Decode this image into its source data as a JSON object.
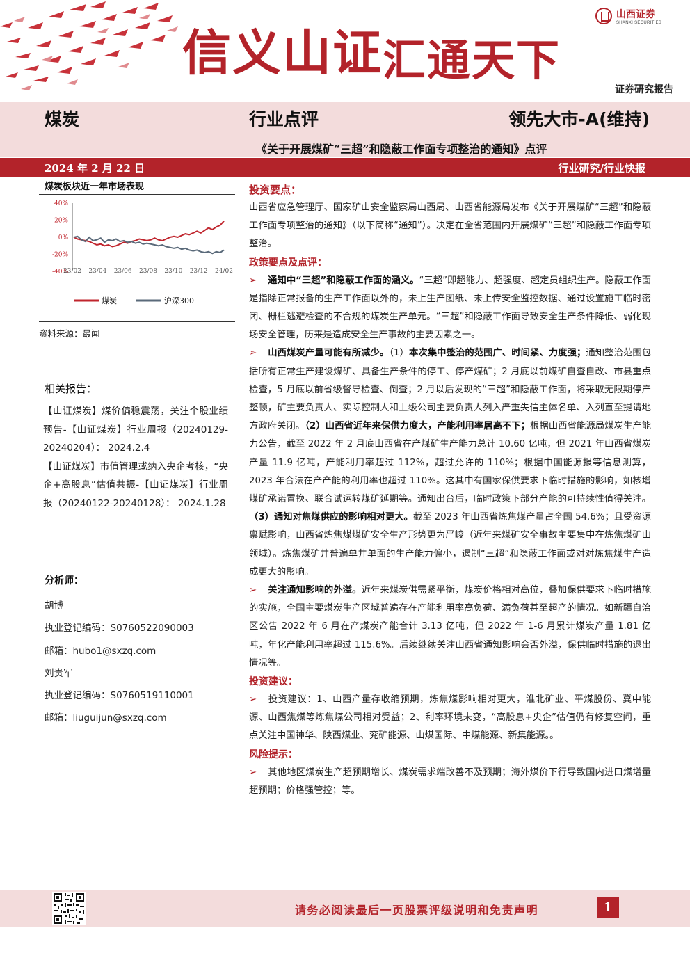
{
  "header": {
    "slogan_part1": "信义山证",
    "slogan_part2": "汇通天下",
    "logo_cn": "山西证券",
    "logo_en": "SHANXI SECURITIES",
    "report_type": "证券研究报告",
    "industry": "煤炭",
    "doc_type": "行业点评",
    "rating": "领先大市-A(维持)",
    "subtitle": "《关于开展煤矿“三超”和隐蔽工作面专项整治的通知》点评",
    "date": "2024 年 2 月 22 日",
    "category": "行业研究/行业快报",
    "colors": {
      "brand_red": "#b3232a",
      "band_pink": "#f3dcdc"
    }
  },
  "sidebar": {
    "chart_title": "煤炭板块近一年市场表现",
    "source": "资料来源：最闻",
    "related_title": "相关报告：",
    "related": [
      "【山证煤炭】煤价偏稳震荡，关注个股业绩预告-【山证煤炭】行业周报（20240129-20240204）：  2024.2.4",
      "【山证煤炭】市值管理或纳入央企考核，“央企+高股息”估值共振-【山证煤炭】行业周报（20240122-20240128）：  2024.1.28"
    ],
    "analyst_title": "分析师：",
    "analysts": [
      {
        "name": "胡博",
        "reg": "执业登记编码：S0760522090003",
        "email": "邮箱：hubo1@sxzq.com"
      },
      {
        "name": "刘贵军",
        "reg": "执业登记编码：S0760519110001",
        "email": "邮箱：liuguijun@sxzq.com"
      }
    ]
  },
  "chart_data": {
    "type": "line",
    "title": "煤炭板块近一年市场表现",
    "x": [
      "23/02",
      "23/04",
      "23/06",
      "23/08",
      "23/10",
      "23/12",
      "24/02"
    ],
    "ylim": [
      -40,
      40
    ],
    "yticks": [
      "40%",
      "20%",
      "0%",
      "-20%",
      "-40%"
    ],
    "series": [
      {
        "name": "煤炭",
        "color": "#c0252d",
        "values": [
          0,
          -2,
          -3,
          -4,
          -5,
          -7,
          -9,
          -8,
          -10,
          -9,
          -11,
          -10,
          -8,
          -6,
          -7,
          -5,
          -4,
          -2,
          -3,
          -4,
          -3,
          -1,
          -3,
          -4,
          -2,
          0,
          1,
          0,
          2,
          4,
          3,
          5,
          7,
          5,
          8,
          11,
          9,
          12,
          14,
          19
        ]
      },
      {
        "name": "沪深300",
        "color": "#5a6a7a",
        "values": [
          0,
          1,
          -3,
          -5,
          0,
          -4,
          -3,
          -1,
          -6,
          -3,
          -4,
          -2,
          -5,
          -4,
          -6,
          -5,
          -7,
          -6,
          -8,
          -7,
          -8,
          -9,
          -10,
          -9,
          -11,
          -12,
          -13,
          -12,
          -14,
          -13,
          -15,
          -16,
          -15,
          -17,
          -18,
          -17,
          -19,
          -17,
          -18,
          -15
        ]
      }
    ],
    "grid": false,
    "legend_position": "bottom"
  },
  "main": {
    "s1_title": "投资要点：",
    "s1_body": "山西省应急管理厅、国家矿山安全监察局山西局、山西省能源局发布《关于开展煤矿“三超”和隐蔽工作面专项整治的通知》（以下简称“通知”）。决定在全省范围内开展煤矿“三超”和隐蔽工作面专项整治。",
    "s2_title": "政策要点及点评：",
    "p1_bold": "通知中“三超”和隐蔽工作面的涵义。",
    "p1_text": "“三超”即超能力、超强度、超定员组织生产。隐蔽工作面是指除正常报备的生产工作面以外的，未上生产图纸、未上传安全监控数据、通过设置施工临时密闭、栅栏逃避检查的不合规的煤炭生产单元。“三超”和隐蔽工作面导致安全生产条件降低、弱化现场安全管理，历来是造成安全生产事故的主要因素之一。",
    "p2_bold1": "山西煤炭产量可能有所减少。",
    "p2_text1": "（1）",
    "p2_bold2": "本次集中整治的范围广、时间紧、力度强；",
    "p2_text2": "通知整治范围包括所有正常生产建设煤矿、具备生产条件的停工、停产煤矿；2 月底以前煤矿自查自改、市县重点检查，5 月底以前省级督导检查、倒查；2 月以后发现的“三超”和隐蔽工作面，将采取无限期停产整顿，矿主要负责人、实际控制人和上级公司主要负责人列入严重失信主体名单、入列直至提请地方政府关闭。",
    "p2_bold3": "（2）山西省近年来保供力度大，产能利用率居高不下；",
    "p2_text3": "根据山西省能源局煤炭生产能力公告，截至 2022 年 2 月底山西省在产煤矿生产能力总计 10.60 亿吨，但 2021 年山西省煤炭产量 11.9 亿吨，产能利用率超过 112%，超过允许的 110%；根据中国能源报等信息测算，2023 年合法在产产能的利用率也超过 110%。这其中有国家保供要求下临时措施的影响，如核增煤矿承诺置换、联合试运转煤矿延期等。通知出台后，临时政策下部分产能的可持续性值得关注。",
    "p2_bold4": "（3）通知对焦煤供应的影响相对更大。",
    "p2_text4": "截至 2023 年山西省炼焦煤产量占全国 54.6%；且受资源禀赋影响，山西省炼焦煤煤矿安全生产形势更为严峻（近年来煤矿安全事故主要集中在炼焦煤矿山领域）。炼焦煤矿井普遍单井单面的生产能力偏小，遏制“三超”和隐蔽工作面或对对炼焦煤生产造成更大的影响。",
    "p3_bold": "关注通知影响的外溢。",
    "p3_text": "近年来煤炭供需紧平衡，煤炭价格相对高位，叠加保供要求下临时措施的实施，全国主要煤炭生产区域普遍存在产能利用率高负荷、满负荷甚至超产的情况。如新疆自治区公告 2022 年 6 月在产煤炭产能合计 3.13 亿吨，但 2022 年 1-6 月累计煤炭产量 1.81 亿吨，年化产能利用率超过 115.6%。后续继续关注山西省通知影响会否外溢，保供临时措施的退出情况等。",
    "s3_title": "投资建议：",
    "p4_text": "投资建议：1、山西产量存收缩预期，炼焦煤影响相对更大，淮北矿业、平煤股份、冀中能源、山西焦煤等炼焦煤公司相对受益；2、利率环境未变，“高股息+央企”估值仍有修复空间，重点关注中国神华、陕西煤业、兖矿能源、山煤国际、中煤能源、新集能源。。",
    "s4_title": "风险提示：",
    "p5_text": "其他地区煤炭生产超预期增长、煤炭需求端改善不及预期；海外煤价下行导致国内进口煤增量超预期；价格强管控；等。"
  },
  "footer": {
    "disclaimer": "请务必阅读最后一页股票评级说明和免责声明",
    "page": "1"
  }
}
